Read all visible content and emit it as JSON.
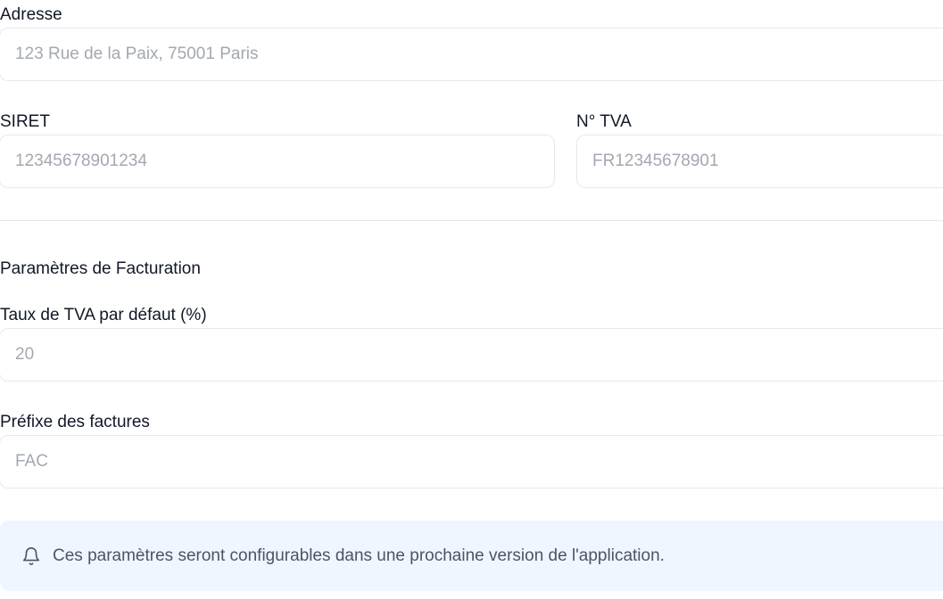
{
  "address": {
    "label": "Adresse",
    "placeholder": "123 Rue de la Paix, 75001 Paris",
    "value": ""
  },
  "siret": {
    "label": "SIRET",
    "placeholder": "12345678901234",
    "value": ""
  },
  "tva_number": {
    "label": "N° TVA",
    "placeholder": "FR12345678901",
    "value": ""
  },
  "billing_section": {
    "title": "Paramètres de Facturation"
  },
  "vat_rate": {
    "label": "Taux de TVA par défaut (%)",
    "placeholder": "20",
    "value": ""
  },
  "invoice_prefix": {
    "label": "Préfixe des factures",
    "placeholder": "FAC",
    "value": ""
  },
  "notice": {
    "icon": "bell-icon",
    "text": "Ces paramètres seront configurables dans une prochaine version de l'application."
  },
  "colors": {
    "notice_background": "#eff6ff",
    "field_border": "#e7e9ee",
    "label_text": "#111827",
    "placeholder_text": "#a3a8b1",
    "notice_text": "#4b5563"
  }
}
